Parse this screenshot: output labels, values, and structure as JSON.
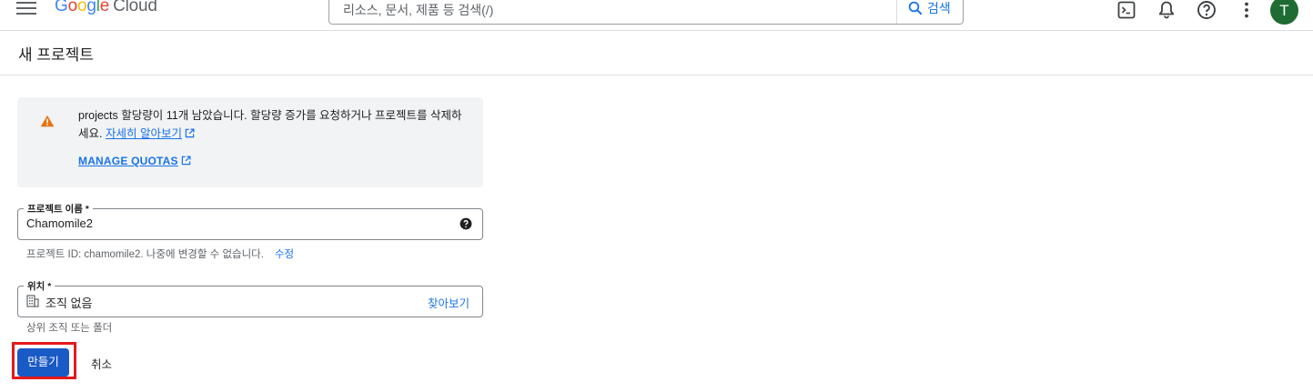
{
  "header": {
    "logo_google": "Google",
    "logo_cloud": "Cloud",
    "search_placeholder": "리소스, 문서, 제품 등 검색(/)",
    "search_button": "검색",
    "avatar_initial": "T"
  },
  "page": {
    "title": "새 프로젝트"
  },
  "warning": {
    "message": "projects 할당량이 11개 남았습니다. 할당량 증가를 요청하거나 프로젝트를 삭제하세요.",
    "learn_more": "자세히 알아보기",
    "manage_quotas": "MANAGE QUOTAS"
  },
  "project_name": {
    "label": "프로젝트 이름 *",
    "value": "Chamomile2",
    "hint_prefix": "프로젝트 ID: ",
    "hint_id": "chamomile2",
    "hint_suffix": ". 나중에 변경할 수 없습니다.",
    "edit_link": "수정"
  },
  "location": {
    "label": "위치 *",
    "value": "조직 없음",
    "browse": "찾아보기",
    "hint": "상위 조직 또는 폴더"
  },
  "actions": {
    "create": "만들기",
    "cancel": "취소"
  },
  "colors": {
    "accent": "#1a73e8",
    "primary_button": "#1a5ac6",
    "warning_icon": "#e8710a",
    "highlight": "#e5191a",
    "avatar": "#1e6b33"
  },
  "icons": [
    "menu-icon",
    "search-icon",
    "terminal-icon",
    "bell-icon",
    "help-icon",
    "more-vert-icon",
    "warning-icon",
    "external-link-icon",
    "organization-icon"
  ]
}
